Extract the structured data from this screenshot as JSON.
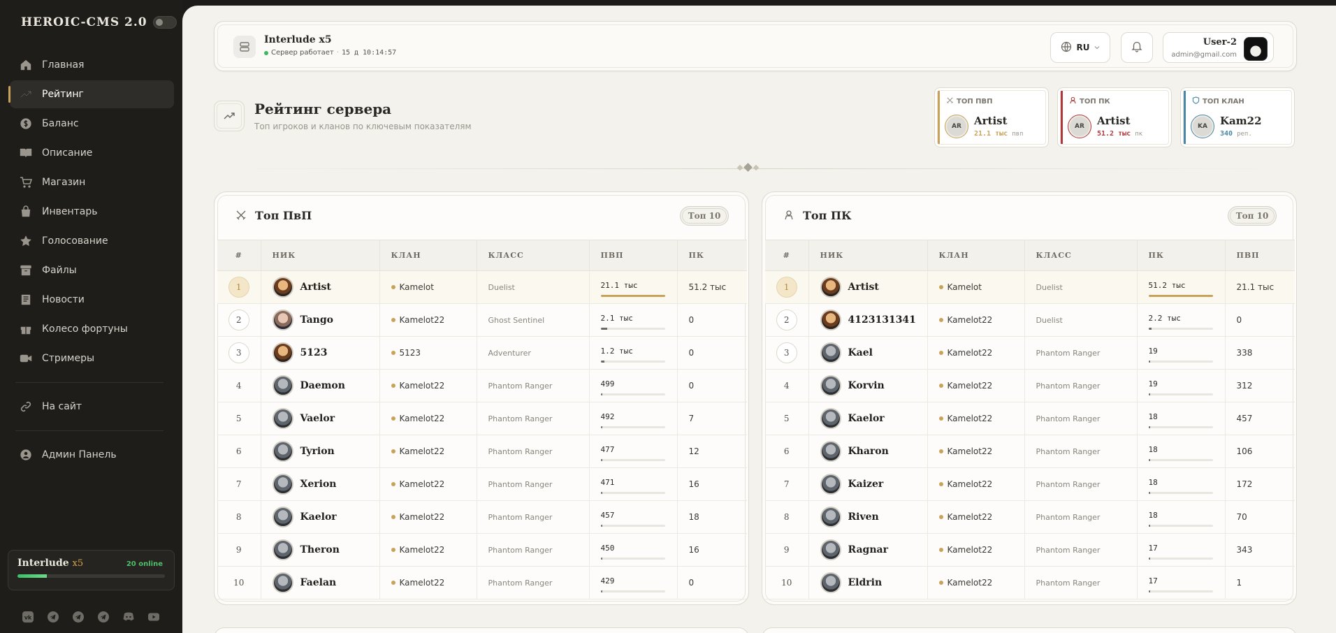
{
  "brand": {
    "title": "HEROIC-CMS 2.0"
  },
  "nav": [
    {
      "label": "Главная",
      "icon": "home-icon"
    },
    {
      "label": "Рейтинг",
      "icon": "trending-up-icon",
      "active": true
    },
    {
      "label": "Баланс",
      "icon": "dollar-icon"
    },
    {
      "label": "Описание",
      "icon": "book-icon"
    },
    {
      "label": "Магазин",
      "icon": "cart-icon"
    },
    {
      "label": "Инвентарь",
      "icon": "bag-icon"
    },
    {
      "label": "Голосование",
      "icon": "star-icon"
    },
    {
      "label": "Файлы",
      "icon": "archive-icon"
    },
    {
      "label": "Новости",
      "icon": "newspaper-icon"
    },
    {
      "label": "Колесо фортуны",
      "icon": "gift-icon"
    },
    {
      "label": "Стримеры",
      "icon": "video-icon"
    }
  ],
  "nav_extra": [
    {
      "label": "На сайт",
      "icon": "link-icon"
    },
    {
      "label": "Админ Панель",
      "icon": "user-circle-icon"
    }
  ],
  "server_box": {
    "name": "Interlude",
    "rate": "x5",
    "online": "20 online",
    "load": 0.2
  },
  "social": [
    "vk-icon",
    "telegram-icon",
    "telegram-icon",
    "telegram-icon",
    "discord-icon",
    "youtube-icon"
  ],
  "topbar": {
    "server_name": "Interlude x5",
    "status": "Сервер работает",
    "uptime": "15 д 10:14:57",
    "lang": "RU",
    "user_name": "User-2",
    "user_email": "admin@gmail.com"
  },
  "page": {
    "title": "Рейтинг сервера",
    "subtitle": "Топ игроков и кланов по ключевым показателям"
  },
  "top_cards": [
    {
      "label": "ТОП ПВП",
      "initials": "AR",
      "name": "Artist",
      "value": "21.1 тыс",
      "unit": "пвп",
      "color": "#c9a25a"
    },
    {
      "label": "ТОП ПК",
      "initials": "AR",
      "name": "Artist",
      "value": "51.2 тыс",
      "unit": "пк",
      "color": "#b0383a"
    },
    {
      "label": "ТОП КЛАН",
      "initials": "KA",
      "name": "Kam22",
      "value": "340",
      "unit": "реп.",
      "color": "#4a87a6"
    }
  ],
  "pvp_table": {
    "title": "Топ ПвП",
    "badge": "Топ 10",
    "headers": [
      "#",
      "НИК",
      "КЛАН",
      "КЛАСС",
      "ПВП",
      "ПК"
    ],
    "rows": [
      {
        "rank": "1",
        "nick": "Artist",
        "clan": "Kamelot",
        "cls": "Duelist",
        "main": "21.1 тыс",
        "pct": 1.0,
        "other": "51.2 тыс",
        "av": "a"
      },
      {
        "rank": "2",
        "nick": "Tango",
        "clan": "Kamelot22",
        "cls": "Ghost Sentinel",
        "main": "2.1 тыс",
        "pct": 0.1,
        "other": "0",
        "av": "b"
      },
      {
        "rank": "3",
        "nick": "5123",
        "clan": "5123",
        "cls": "Adventurer",
        "main": "1.2 тыс",
        "pct": 0.06,
        "other": "0",
        "av": "a"
      },
      {
        "rank": "4",
        "nick": "Daemon",
        "clan": "Kamelot22",
        "cls": "Phantom Ranger",
        "main": "499",
        "pct": 0.03,
        "other": "0",
        "av": "c"
      },
      {
        "rank": "5",
        "nick": "Vaelor",
        "clan": "Kamelot22",
        "cls": "Phantom Ranger",
        "main": "492",
        "pct": 0.03,
        "other": "7",
        "av": "c"
      },
      {
        "rank": "6",
        "nick": "Tyrion",
        "clan": "Kamelot22",
        "cls": "Phantom Ranger",
        "main": "477",
        "pct": 0.03,
        "other": "12",
        "av": "c"
      },
      {
        "rank": "7",
        "nick": "Xerion",
        "clan": "Kamelot22",
        "cls": "Phantom Ranger",
        "main": "471",
        "pct": 0.03,
        "other": "16",
        "av": "c"
      },
      {
        "rank": "8",
        "nick": "Kaelor",
        "clan": "Kamelot22",
        "cls": "Phantom Ranger",
        "main": "457",
        "pct": 0.03,
        "other": "18",
        "av": "c"
      },
      {
        "rank": "9",
        "nick": "Theron",
        "clan": "Kamelot22",
        "cls": "Phantom Ranger",
        "main": "450",
        "pct": 0.03,
        "other": "16",
        "av": "c"
      },
      {
        "rank": "10",
        "nick": "Faelan",
        "clan": "Kamelot22",
        "cls": "Phantom Ranger",
        "main": "429",
        "pct": 0.03,
        "other": "0",
        "av": "c"
      }
    ]
  },
  "pk_table": {
    "title": "Топ ПК",
    "badge": "Топ 10",
    "headers": [
      "#",
      "НИК",
      "КЛАН",
      "КЛАСС",
      "ПК",
      "ПВП"
    ],
    "rows": [
      {
        "rank": "1",
        "nick": "Artist",
        "clan": "Kamelot",
        "cls": "Duelist",
        "main": "51.2 тыс",
        "pct": 1.0,
        "other": "21.1 тыс",
        "av": "a"
      },
      {
        "rank": "2",
        "nick": "4123131341",
        "clan": "Kamelot22",
        "cls": "Duelist",
        "main": "2.2 тыс",
        "pct": 0.05,
        "other": "0",
        "av": "a"
      },
      {
        "rank": "3",
        "nick": "Kael",
        "clan": "Kamelot22",
        "cls": "Phantom Ranger",
        "main": "19",
        "pct": 0.02,
        "other": "338",
        "av": "c"
      },
      {
        "rank": "4",
        "nick": "Korvin",
        "clan": "Kamelot22",
        "cls": "Phantom Ranger",
        "main": "19",
        "pct": 0.02,
        "other": "312",
        "av": "c"
      },
      {
        "rank": "5",
        "nick": "Kaelor",
        "clan": "Kamelot22",
        "cls": "Phantom Ranger",
        "main": "18",
        "pct": 0.02,
        "other": "457",
        "av": "c"
      },
      {
        "rank": "6",
        "nick": "Kharon",
        "clan": "Kamelot22",
        "cls": "Phantom Ranger",
        "main": "18",
        "pct": 0.02,
        "other": "106",
        "av": "c"
      },
      {
        "rank": "7",
        "nick": "Kaizer",
        "clan": "Kamelot22",
        "cls": "Phantom Ranger",
        "main": "18",
        "pct": 0.02,
        "other": "172",
        "av": "c"
      },
      {
        "rank": "8",
        "nick": "Riven",
        "clan": "Kamelot22",
        "cls": "Phantom Ranger",
        "main": "18",
        "pct": 0.02,
        "other": "70",
        "av": "c"
      },
      {
        "rank": "9",
        "nick": "Ragnar",
        "clan": "Kamelot22",
        "cls": "Phantom Ranger",
        "main": "17",
        "pct": 0.02,
        "other": "343",
        "av": "c"
      },
      {
        "rank": "10",
        "nick": "Eldrin",
        "clan": "Kamelot22",
        "cls": "Phantom Ranger",
        "main": "17",
        "pct": 0.02,
        "other": "1",
        "av": "c"
      }
    ]
  }
}
